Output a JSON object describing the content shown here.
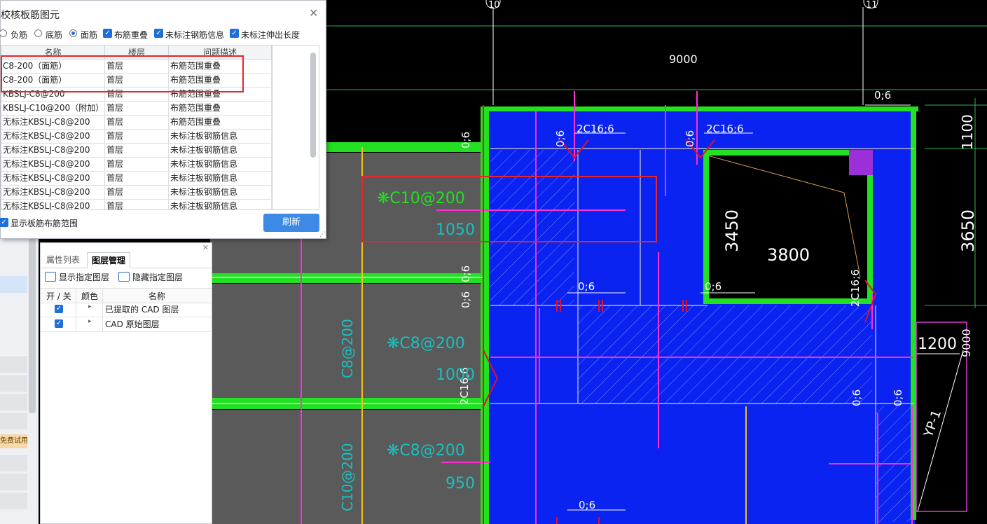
{
  "dialog": {
    "title": "校核板筋图元",
    "options": {
      "negative": "负筋",
      "bottom": "底筋",
      "top": "面筋",
      "check_overlap": "布筋重叠",
      "check_unlabeled_info": "未标注钢筋信息",
      "check_unlabeled_length": "未标注伸出长度"
    },
    "columns": [
      "名称",
      "楼层",
      "问题描述"
    ],
    "rows": [
      [
        "C8-200（面筋）",
        "首层",
        "布筋范围重叠"
      ],
      [
        "C8-200（面筋）",
        "首层",
        "布筋范围重叠"
      ],
      [
        "KBSLJ-C8@200",
        "首层",
        "布筋范围重叠"
      ],
      [
        "KBSLJ-C10@200（附加）",
        "首层",
        "布筋范围重叠"
      ],
      [
        "无标注KBSLJ-C8@200",
        "首层",
        "布筋范围重叠"
      ],
      [
        "无标注KBSLJ-C8@200",
        "首层",
        "未标注板钢筋信息"
      ],
      [
        "无标注KBSLJ-C8@200",
        "首层",
        "未标注板钢筋信息"
      ],
      [
        "无标注KBSLJ-C8@200",
        "首层",
        "未标注板钢筋信息"
      ],
      [
        "无标注KBSLJ-C8@200",
        "首层",
        "未标注板钢筋信息"
      ],
      [
        "无标注KBSLJ-C8@200",
        "首层",
        "未标注板钢筋信息"
      ],
      [
        "无标注KBSLJ-C8@200",
        "首层",
        "未标注板钢筋信息"
      ]
    ],
    "show_range_label": "显示板筋布筋范围",
    "refresh_label": "刷新"
  },
  "layer_panel": {
    "tab_properties": "属性列表",
    "tab_layers": "图层管理",
    "show_layer": "显示指定图层",
    "hide_layer": "隐藏指定图层",
    "col_toggle": "开 / 关",
    "col_color": "颜色",
    "col_name": "名称",
    "layers": [
      "已提取的 CAD 图层",
      "CAD 原始图层"
    ]
  },
  "side": {
    "trial_tag": "免费试用"
  },
  "cad": {
    "axis_10": "10",
    "axis_11": "11",
    "dim_9000": "9000",
    "dim_3450": "3450",
    "dim_3800": "3800",
    "dim_3650": "3650",
    "dim_1100": "1100",
    "dim_1200": "1200",
    "dim_9000_v": "9000",
    "lbl_06": "0;6",
    "lbl_2c16": "2C16;6",
    "lbl_c10": "❋C10@200",
    "lbl_c8": "❋C8@200",
    "lbl_1050": "1050",
    "lbl_1000": "1000",
    "lbl_950": "950",
    "lbl_yp": "YP-1",
    "lbl_c8_200": "C8@200",
    "lbl_c10_200": "C10@200"
  },
  "colors": {
    "slab_blue": "#0a23f0",
    "beam_green": "#22e022",
    "rebar_magenta": "#ff2fd6",
    "rebar_red": "#e0102a",
    "highlight_red": "#e5262a",
    "slab_gray": "#5a5a5a",
    "accent_button": "#3c8ae6"
  }
}
